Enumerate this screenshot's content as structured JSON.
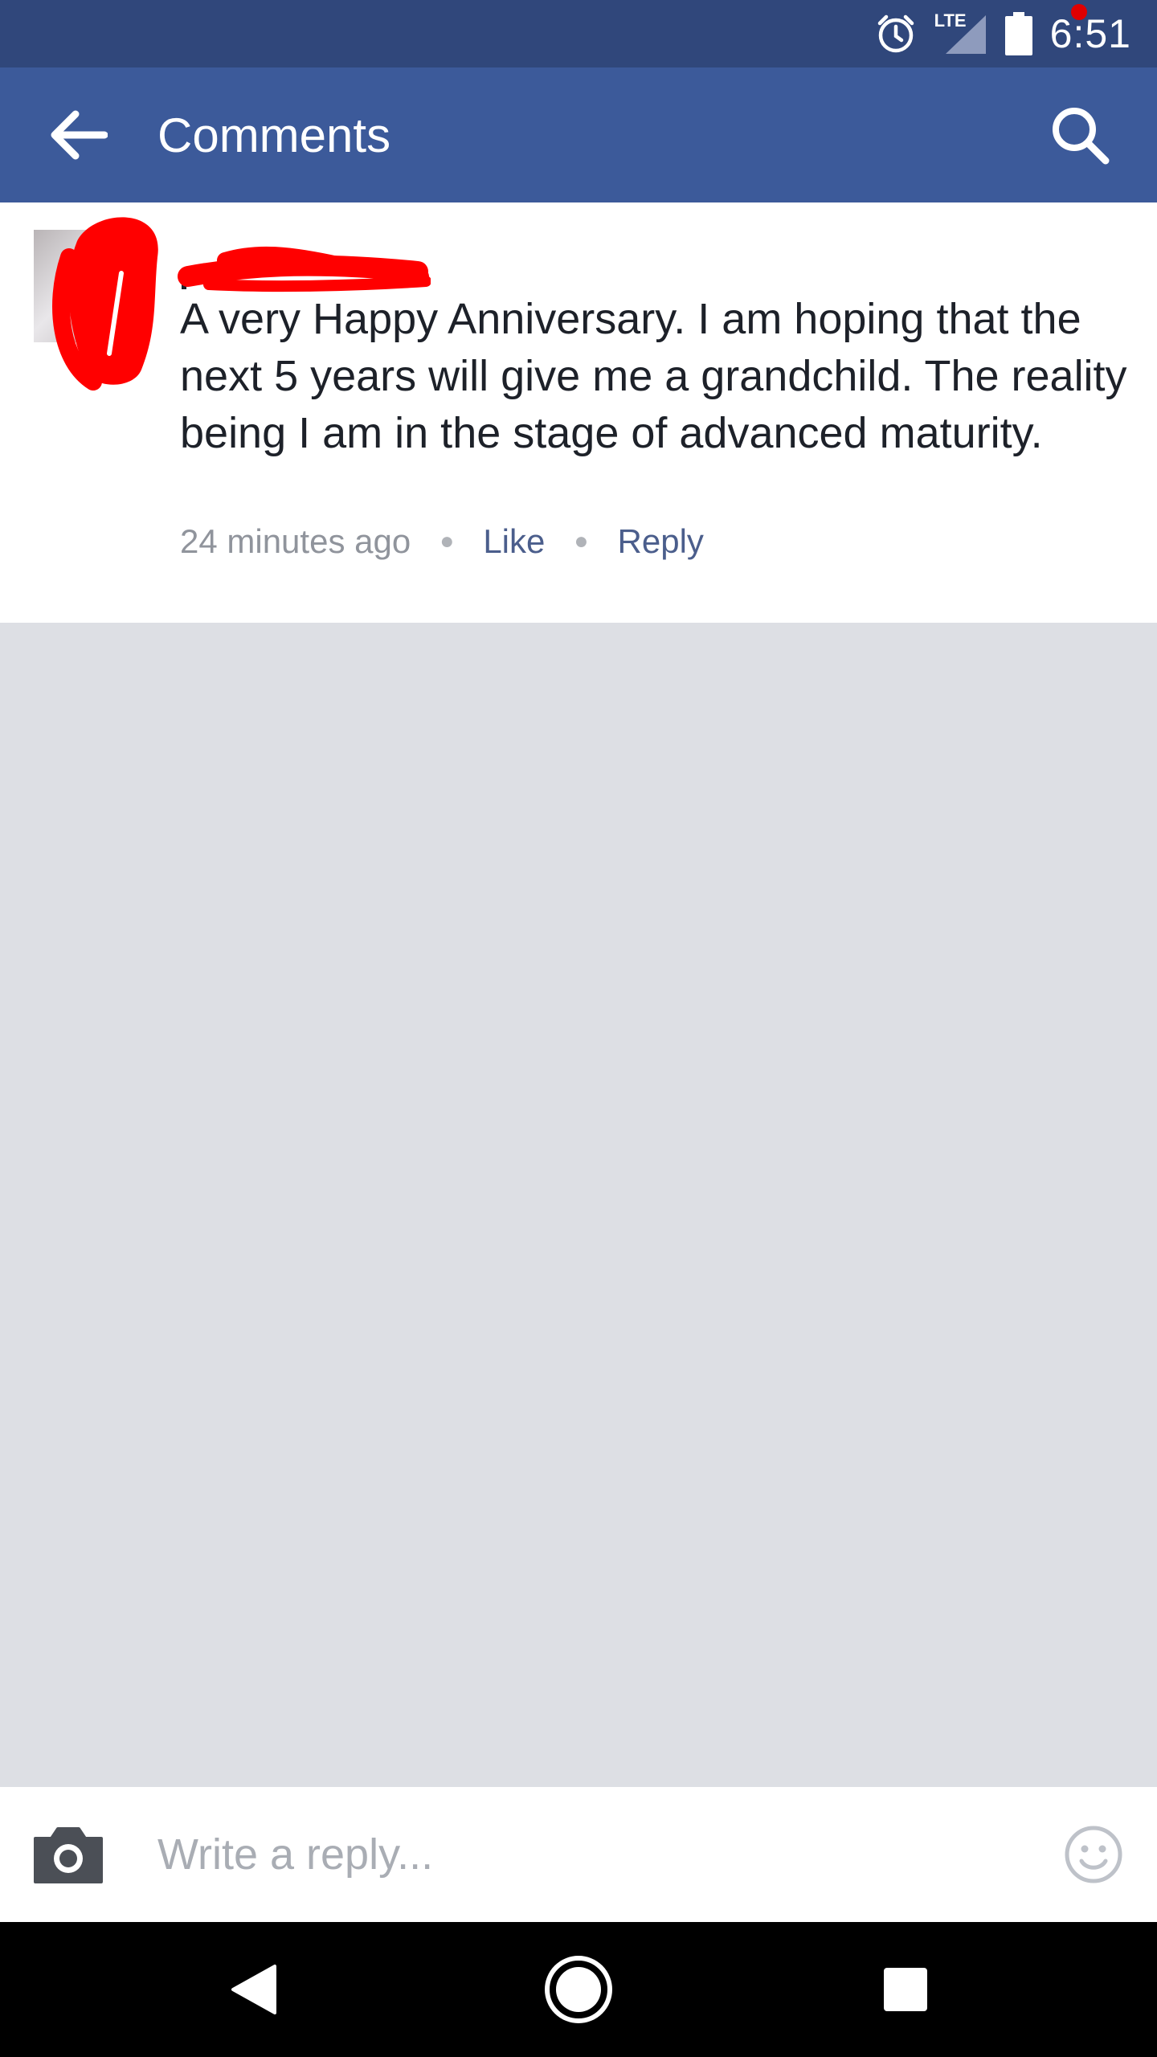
{
  "status_bar": {
    "network_label": "LTE",
    "time": "6:51"
  },
  "app_bar": {
    "title": "Comments",
    "back_icon": "arrow-back-icon",
    "search_icon": "search-icon"
  },
  "comment": {
    "author": "",
    "text": "A very Happy Anniversary. I am hoping that the next 5 years will give me a grandchild. The reality being I am in the stage of advanced maturity.",
    "timestamp": "24 minutes ago",
    "like_label": "Like",
    "reply_label": "Reply"
  },
  "reply_bar": {
    "placeholder": "Write a reply...",
    "value": ""
  },
  "colors": {
    "status_bar": "#30477b",
    "app_bar": "#3c5a9a",
    "link": "#4b5e8c",
    "background": "#dddfe4",
    "redaction": "#ff0000"
  }
}
